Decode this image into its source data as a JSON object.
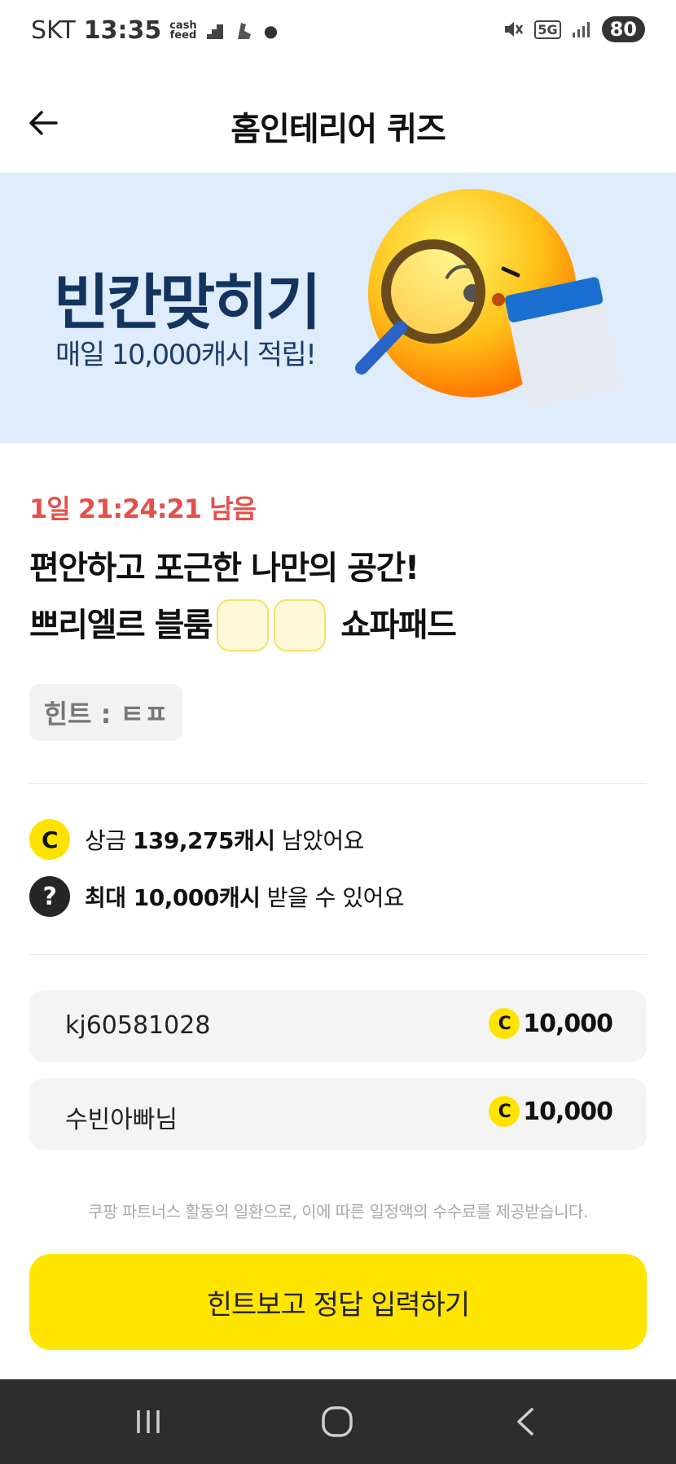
{
  "status_bar": {
    "carrier": "SKT",
    "time": "13:35",
    "mini_logo_top": "cash",
    "mini_logo_bottom": "feed",
    "battery": "80",
    "network": "5G"
  },
  "header": {
    "title": "홈인테리어 퀴즈"
  },
  "banner": {
    "title": "빈칸맞히기",
    "subtitle": "매일 10,000캐시 적립!"
  },
  "quiz": {
    "timer": "1일 21:24:21 남음",
    "line1": "편안하고 포근한 나만의 공간!",
    "line2_prefix": "쁘리엘르 블룸",
    "line2_suffix": "쇼파패드",
    "hint": "힌트 : ㅌㅍ"
  },
  "info": {
    "prize_prefix": "상금",
    "prize_amount": "139,275캐시",
    "prize_suffix": "남았어요",
    "max_amount": "최대 10,000캐시",
    "max_suffix": "받을 수 있어요",
    "coin_letter": "C",
    "question_mark": "?"
  },
  "winners": [
    {
      "name": "kj60581028",
      "amount": "10,000"
    },
    {
      "name": "수빈아빠님",
      "amount": "10,000"
    }
  ],
  "disclaimer": "쿠팡 파트너스 활동의 일환으로, 이에 따른 일정액의 수수료를 제공받습니다.",
  "cta": {
    "label": "힌트보고 정답 입력하기"
  },
  "colors": {
    "accent": "#ffe500",
    "timer": "#e4514a",
    "banner_bg": "#dfecfb",
    "banner_text": "#12345f"
  }
}
